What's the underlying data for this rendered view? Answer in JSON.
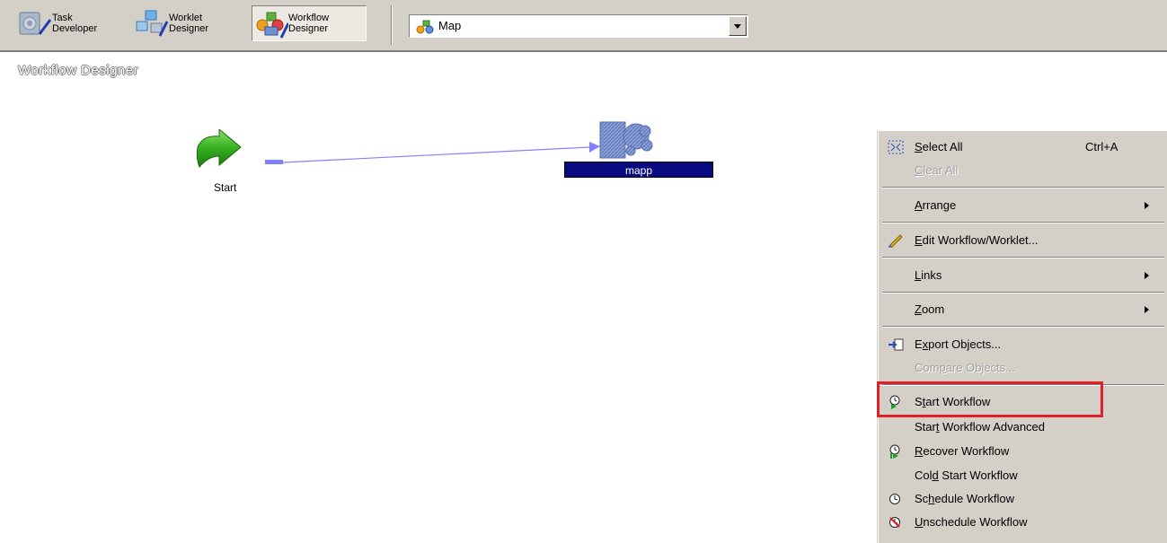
{
  "toolbar": {
    "task_developer": {
      "line1": "Task",
      "line2": "Developer"
    },
    "worklet_designer": {
      "line1": "Worklet",
      "line2": "Designer"
    },
    "workflow_designer": {
      "line1": "Workflow",
      "line2": "Designer"
    },
    "combo": {
      "value": "Map"
    }
  },
  "canvas": {
    "title": "Workflow Designer",
    "start_label": "Start",
    "session_label": "mapp"
  },
  "context_menu": {
    "select_all": {
      "label_pre": "",
      "mnemonic": "S",
      "label_post": "elect All",
      "accel": "Ctrl+A"
    },
    "clear_all": {
      "label_pre": "",
      "mnemonic": "C",
      "label_post": "lear All"
    },
    "arrange": {
      "label_pre": "",
      "mnemonic": "A",
      "label_post": "rrange"
    },
    "edit_workflow": {
      "label_pre": "",
      "mnemonic": "E",
      "label_post": "dit Workflow/Worklet..."
    },
    "links": {
      "label_pre": "",
      "mnemonic": "L",
      "label_post": "inks"
    },
    "zoom": {
      "label_pre": "",
      "mnemonic": "Z",
      "label_post": "oom"
    },
    "export_objects": {
      "label_pre": "E",
      "mnemonic": "x",
      "label_post": "port Objects..."
    },
    "compare_objects": {
      "label_pre": "Com",
      "mnemonic": "p",
      "label_post": "are Objects..."
    },
    "start_workflow": {
      "label_pre": "S",
      "mnemonic": "t",
      "label_post": "art Workflow"
    },
    "start_workflow_advanced": {
      "label_pre": "Star",
      "mnemonic": "t",
      "label_post": " Workflow Advanced"
    },
    "recover_workflow": {
      "label_pre": "",
      "mnemonic": "R",
      "label_post": "ecover Workflow"
    },
    "cold_start_workflow": {
      "label_pre": "Col",
      "mnemonic": "d",
      "label_post": " Start Workflow"
    },
    "schedule_workflow": {
      "label_pre": "Sc",
      "mnemonic": "h",
      "label_post": "edule Workflow"
    },
    "unschedule_workflow": {
      "label_pre": "",
      "mnemonic": "U",
      "label_post": "nschedule Workflow"
    }
  },
  "colors": {
    "chrome": "#d4d0c8",
    "session_label_bg": "#0a0a80",
    "highlight": "#e0202a",
    "link": "#8080ff"
  }
}
